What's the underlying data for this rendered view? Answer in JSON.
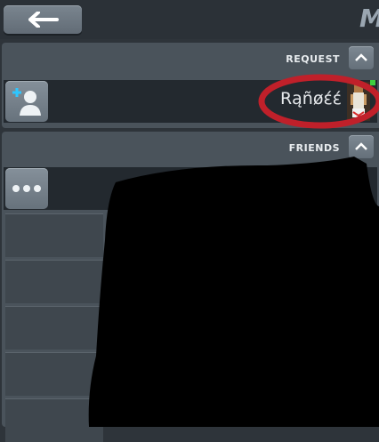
{
  "header": {
    "back_icon": "arrow-left-icon",
    "title_partial": "M"
  },
  "request": {
    "heading": "REQUEST",
    "add_icon": "add-friend-icon",
    "player_name": "Rąñøέέ"
  },
  "friends": {
    "heading": "FRIENDS",
    "more_icon": "more-options-icon"
  },
  "colors": {
    "accent_circle": "#c0202a",
    "panel": "#4a535b",
    "row": "#23292f"
  }
}
